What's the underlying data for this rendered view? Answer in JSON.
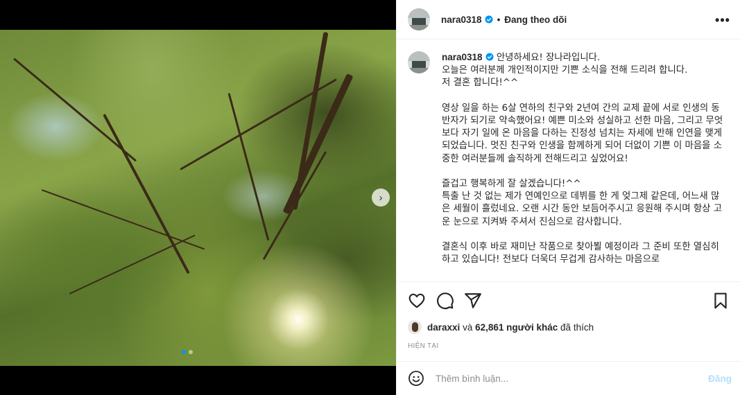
{
  "header": {
    "username": "nara0318",
    "separator": "•",
    "follow_status": "Đang theo dõi",
    "more_label": "•••"
  },
  "caption": {
    "username": "nara0318",
    "text": "안녕하세요! 장나라입니다.\n오늘은 여러분께 개인적이지만 기쁜 소식을 전해 드리려 합니다.\n저 결혼 합니다!^^\n\n영상 일을 하는 6살 연하의 친구와 2년여 간의 교제 끝에 서로 인생의 동반자가 되기로 약속했어요! 예쁜 미소와 성실하고 선한 마음, 그리고 무엇보다 자기 일에 온 마음을 다하는 진정성 넘치는 자세에 반해 인연을 맺게 되었습니다. 멋진 친구와 인생을 함께하게 되어 더없이 기쁜 이 마음을 소중한 여러분들께 솔직하게 전해드리고 싶었어요!\n\n즐겁고 행복하게 잘 살겠습니다!^^\n특출 난 것 없는 제가 연예인으로 데뷔를 한 게 엊그제 같은데, 어느새 많은 세월이 흘렀네요. 오랜 시간 동안 보듬어주시고 응원해 주시며 항상 고운 눈으로 지켜봐 주셔서 진심으로 감사합니다.\n\n결혼식 이후 바로 재미난 작품으로 찾아뵐 예정이라 그 준비 또한 열심히 하고 있습니다! 전보다 더욱더 무겁게 감사하는 마음으로"
  },
  "likes": {
    "first_user": "daraxxi",
    "and_text": "và",
    "others": "62,861 người khác",
    "suffix": "đã thích"
  },
  "timestamp": "HIỆN TẠI",
  "comment": {
    "placeholder": "Thêm bình luận...",
    "post_label": "Đăng"
  },
  "carousel": {
    "slide_count": 2,
    "active_index": 0
  },
  "colors": {
    "verified": "#0095f6",
    "post_disabled": "#b2dffc",
    "muted": "#8e8e8e"
  },
  "icons": [
    "more-icon",
    "verified-badge-icon",
    "heart-icon",
    "comment-icon",
    "share-icon",
    "save-icon",
    "emoji-icon",
    "next-arrow-icon"
  ]
}
